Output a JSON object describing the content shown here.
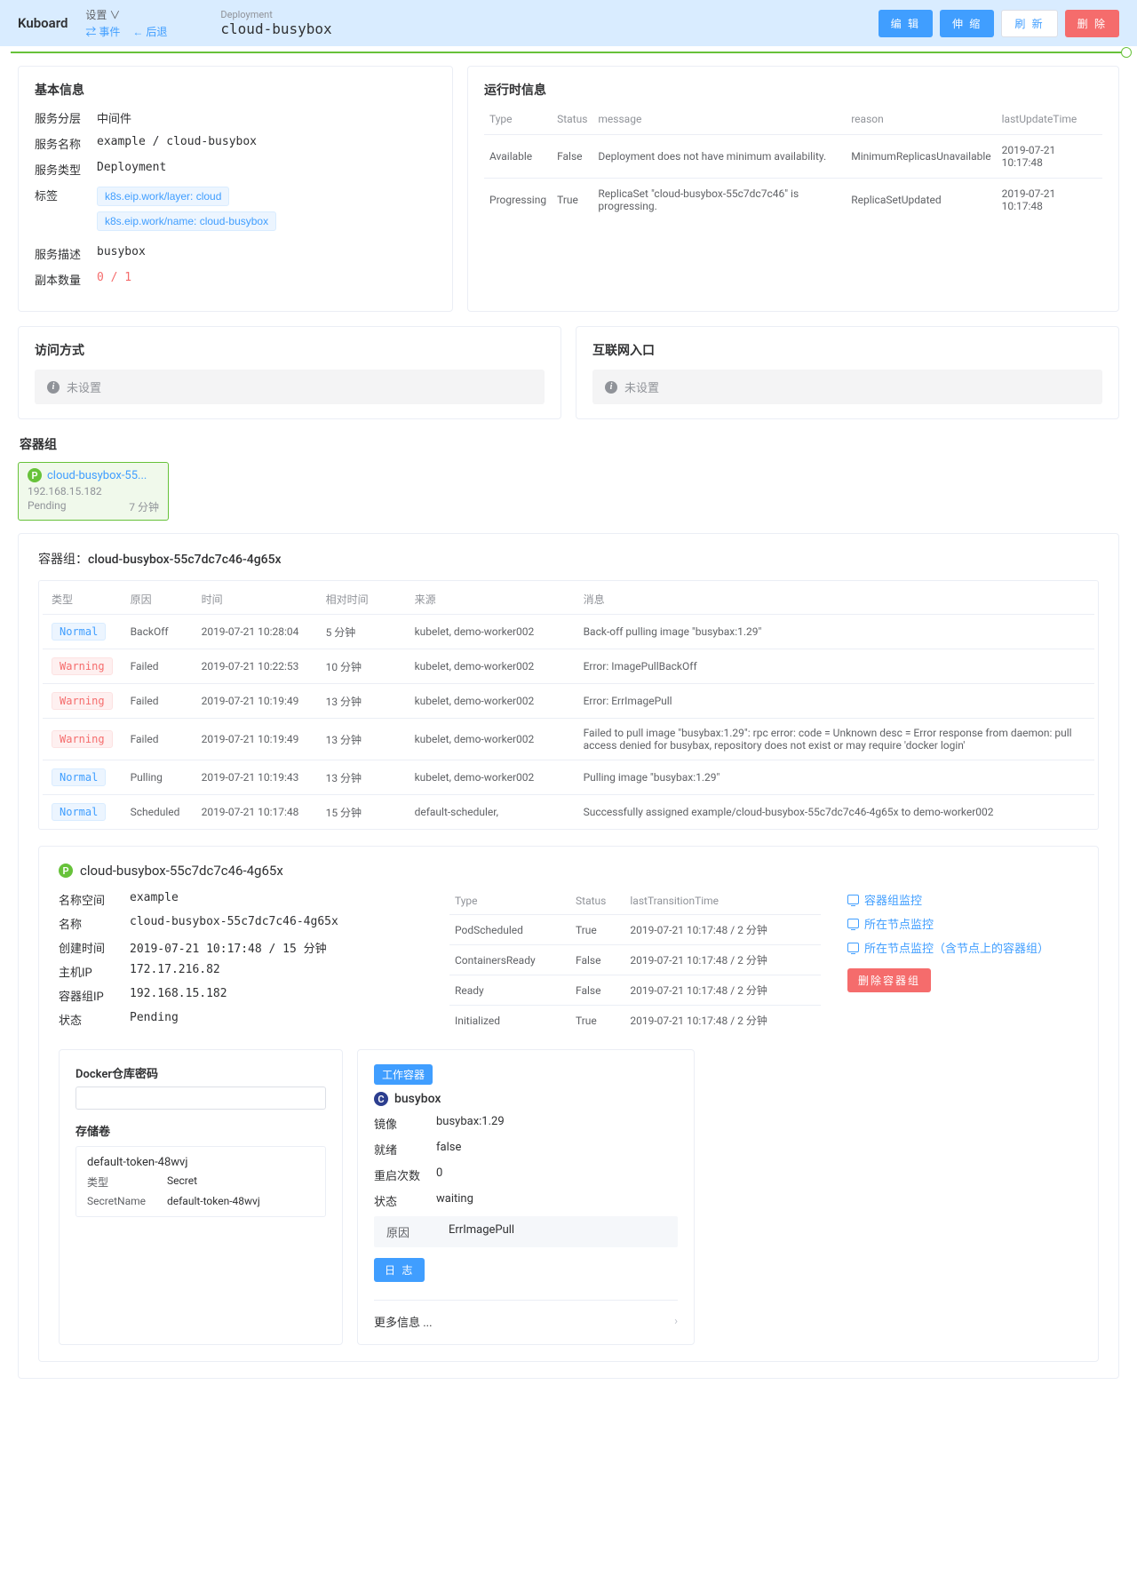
{
  "header": {
    "brand": "Kuboard",
    "settings": "设置",
    "events": "事件",
    "back": "后退",
    "deployment_label": "Deployment",
    "deployment_name": "cloud-busybox",
    "actions": {
      "edit": "编 辑",
      "scale": "伸 缩",
      "refresh": "刷 新",
      "delete": "删 除"
    }
  },
  "basic": {
    "title": "基本信息",
    "labels": {
      "layer": "服务分层",
      "name": "服务名称",
      "type": "服务类型",
      "tags": "标签",
      "desc": "服务描述",
      "replicas": "副本数量"
    },
    "layer": "中间件",
    "name": "example / cloud-busybox",
    "type": "Deployment",
    "tags": [
      "k8s.eip.work/layer: cloud",
      "k8s.eip.work/name: cloud-busybox"
    ],
    "desc": "busybox",
    "replicas": "0 / 1"
  },
  "runtime": {
    "title": "运行时信息",
    "cols": {
      "type": "Type",
      "status": "Status",
      "message": "message",
      "reason": "reason",
      "time": "lastUpdateTime"
    },
    "rows": [
      {
        "type": "Available",
        "status": "False",
        "message": "Deployment does not have minimum availability.",
        "reason": "MinimumReplicasUnavailable",
        "time": "2019-07-21 10:17:48"
      },
      {
        "type": "Progressing",
        "status": "True",
        "message": "ReplicaSet \"cloud-busybox-55c7dc7c46\" is progressing.",
        "reason": "ReplicaSetUpdated",
        "time": "2019-07-21 10:17:48"
      }
    ]
  },
  "access": {
    "title": "访问方式",
    "notice": "未设置"
  },
  "internet": {
    "title": "互联网入口",
    "notice": "未设置"
  },
  "pods_title": "容器组",
  "pod_card": {
    "name": "cloud-busybox-55...",
    "ip": "192.168.15.182",
    "state": "Pending",
    "age": "7 分钟"
  },
  "detail": {
    "title_prefix": "容器组：",
    "title_name": "cloud-busybox-55c7dc7c46-4g65x",
    "cols": {
      "type": "类型",
      "reason": "原因",
      "time": "时间",
      "rel": "相对时间",
      "source": "来源",
      "msg": "消息"
    },
    "events": [
      {
        "lvl": "Normal",
        "reason": "BackOff",
        "time": "2019-07-21 10:28:04",
        "rel": "5 分钟",
        "src": "kubelet, demo-worker002",
        "msg": "Back-off pulling image \"busybax:1.29\""
      },
      {
        "lvl": "Warning",
        "reason": "Failed",
        "time": "2019-07-21 10:22:53",
        "rel": "10 分钟",
        "src": "kubelet, demo-worker002",
        "msg": "Error: ImagePullBackOff"
      },
      {
        "lvl": "Warning",
        "reason": "Failed",
        "time": "2019-07-21 10:19:49",
        "rel": "13 分钟",
        "src": "kubelet, demo-worker002",
        "msg": "Error: ErrImagePull"
      },
      {
        "lvl": "Warning",
        "reason": "Failed",
        "time": "2019-07-21 10:19:49",
        "rel": "13 分钟",
        "src": "kubelet, demo-worker002",
        "msg": "Failed to pull image \"busybax:1.29\": rpc error: code = Unknown desc = Error response from daemon: pull access denied for busybax, repository does not exist or may require 'docker login'"
      },
      {
        "lvl": "Normal",
        "reason": "Pulling",
        "time": "2019-07-21 10:19:43",
        "rel": "13 分钟",
        "src": "kubelet, demo-worker002",
        "msg": "Pulling image \"busybax:1.29\""
      },
      {
        "lvl": "Normal",
        "reason": "Scheduled",
        "time": "2019-07-21 10:17:48",
        "rel": "15 分钟",
        "src": "default-scheduler,",
        "msg": "Successfully assigned example/cloud-busybox-55c7dc7c46-4g65x to demo-worker002"
      }
    ]
  },
  "pod": {
    "name": "cloud-busybox-55c7dc7c46-4g65x",
    "labels": {
      "ns": "名称空间",
      "name": "名称",
      "created": "创建时间",
      "hostip": "主机IP",
      "podip": "容器组IP",
      "state": "状态"
    },
    "ns": "example",
    "pod_name": "cloud-busybox-55c7dc7c46-4g65x",
    "created": "2019-07-21 10:17:48 / 15 分钟",
    "hostip": "172.17.216.82",
    "podip": "192.168.15.182",
    "state": "Pending",
    "cond_cols": {
      "type": "Type",
      "status": "Status",
      "time": "lastTransitionTime"
    },
    "conds": [
      {
        "type": "PodScheduled",
        "status": "True",
        "time": "2019-07-21 10:17:48 / 2 分钟"
      },
      {
        "type": "ContainersReady",
        "status": "False",
        "time": "2019-07-21 10:17:48 / 2 分钟"
      },
      {
        "type": "Ready",
        "status": "False",
        "time": "2019-07-21 10:17:48 / 2 分钟"
      },
      {
        "type": "Initialized",
        "status": "True",
        "time": "2019-07-21 10:17:48 / 2 分钟"
      }
    ],
    "links": {
      "pod_monitor": "容器组监控",
      "node_monitor": "所在节点监控",
      "node_monitor_all": "所在节点监控（含节点上的容器组）"
    },
    "delete_pod": "删除容器组"
  },
  "docker": {
    "title": "Docker仓库密码",
    "vol_title": "存储卷",
    "vol_name": "default-token-48wvj",
    "vol_kv": {
      "type_label": "类型",
      "type_val": "Secret",
      "secret_label": "SecretName",
      "secret_val": "default-token-48wvj"
    }
  },
  "container": {
    "work_badge": "工作容器",
    "name": "busybox",
    "labels": {
      "image": "镜像",
      "ready": "就绪",
      "restart": "重启次数",
      "state": "状态",
      "reason": "原因"
    },
    "image": "busybax:1.29",
    "ready": "false",
    "restart": "0",
    "state": "waiting",
    "reason": "ErrImagePull",
    "log_btn": "日 志",
    "more": "更多信息 ..."
  }
}
